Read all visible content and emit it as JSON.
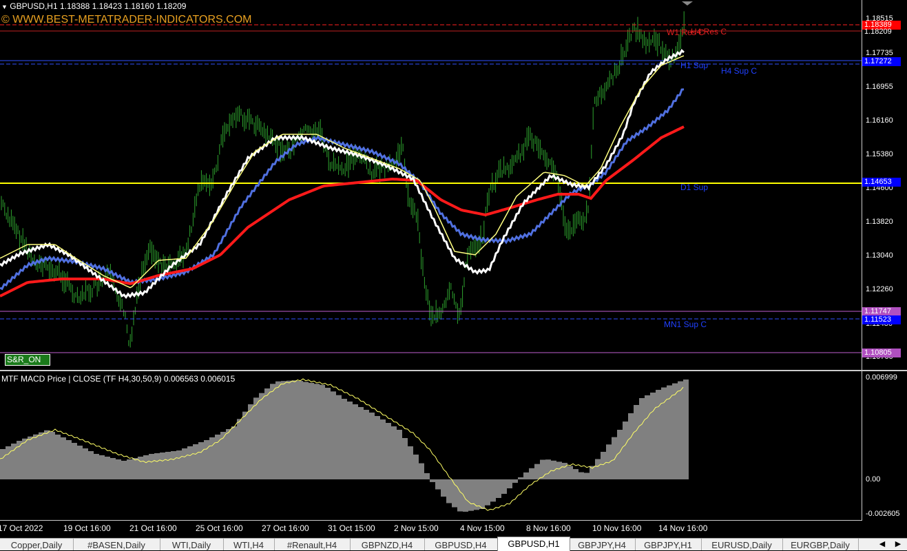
{
  "header": {
    "title": "GBPUSD,H1  1.18388 1.18423 1.18160 1.18209",
    "watermark": "© WWW.BEST-METATRADER-INDICATORS.COM",
    "sr_button": "S&R_ON"
  },
  "price_axis": {
    "ticks": [
      "1.18515",
      "1.17735",
      "1.16955",
      "1.16160",
      "1.15380",
      "1.14600",
      "1.13820",
      "1.13040",
      "1.12260",
      "1.11480",
      "1.10700"
    ]
  },
  "price_badges": [
    {
      "text": "1.18389",
      "color": "#ff0000"
    },
    {
      "text": "1.18209",
      "color": "#000000"
    },
    {
      "text": "1.17272",
      "color": "#0000ff"
    },
    {
      "text": "1.14653",
      "color": "#0000ff"
    },
    {
      "text": "1.11747",
      "color": "#b050c0"
    },
    {
      "text": "1.11523",
      "color": "#0000ff"
    },
    {
      "text": "1.10805",
      "color": "#b050c0"
    }
  ],
  "levels": {
    "w1_res": "W1 Res C",
    "h4_res": "H4 Res C",
    "h1_sup": "H1 Sup",
    "h4_sup": "H4 Sup C",
    "d1_sup": "D1 Sup",
    "mn1_sup": "MN1 Sup C"
  },
  "macd": {
    "label": "MTF MACD Price | CLOSE  (TF H4,30,50,9) 0.006563 0.006015",
    "axis": [
      "0.006999",
      "0.00",
      "-0.002605"
    ]
  },
  "time_axis": [
    "17 Oct 2022",
    "19 Oct 16:00",
    "21 Oct 16:00",
    "25 Oct 16:00",
    "27 Oct 16:00",
    "31 Oct 15:00",
    "2 Nov 15:00",
    "4 Nov 15:00",
    "8 Nov 16:00",
    "10 Nov 16:00",
    "14 Nov 16:00"
  ],
  "tabs": [
    "Copper,Daily",
    "#BASEN,Daily",
    "WTI,Daily",
    "WTI,H4",
    "#Renault,H4",
    "GBPNZD,H4",
    "GBPUSD,H4",
    "GBPUSD,H1",
    "GBPJPY,H4",
    "GBPJPY,H1",
    "EURUSD,Daily",
    "EURGBP,Daily"
  ],
  "active_tab": "GBPUSD,H1",
  "nav": {
    "left": "◀",
    "right": "▶"
  },
  "colors": {
    "background": "#000000",
    "candles": "#2fa52f",
    "ma_red": "#ff1a1a",
    "ma_blue": "#5070e0",
    "ma_white": "#ffffff",
    "ma_yellow": "#ffff80",
    "d1_line": "#ffff00",
    "macd_hist": "#808080",
    "macd_signal": "#ffff66"
  }
}
